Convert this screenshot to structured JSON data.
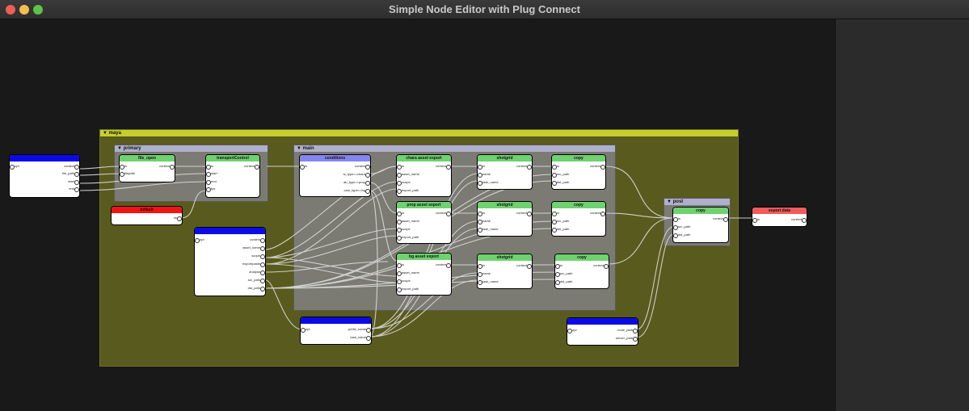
{
  "window": {
    "title": "Simple Node Editor with Plug Connect",
    "controls": [
      "close",
      "minimize",
      "zoom"
    ]
  },
  "colors": {
    "maya_group": "#595a1e",
    "maya_header": "#c5cf2c",
    "subgroup": "#7b7b74",
    "subgroup_header": "#b0b0cc",
    "node_green": "#6fd16f",
    "node_blue": "#0a0ae6",
    "node_red": "#f01414",
    "node_lavender": "#8585f0",
    "node_salmon": "#f25b5b"
  },
  "groups": {
    "maya": {
      "label": "maya"
    },
    "primary": {
      "label": "primary"
    },
    "main": {
      "label": "main"
    },
    "post": {
      "label": "post"
    }
  },
  "nodes": {
    "input_params": {
      "title": "",
      "outputs": [
        "opt",
        "context",
        "file_path",
        "start",
        "end"
      ]
    },
    "file_open": {
      "title": "file_open",
      "inputs": [
        "in",
        "filepath"
      ],
      "outputs": [
        "context"
      ]
    },
    "transportControl": {
      "title": "transportControl",
      "inputs": [
        "in",
        "start",
        "end",
        "fps"
      ],
      "outputs": [
        "context"
      ]
    },
    "default": {
      "title": "default",
      "outputs": [
        "ok"
      ]
    },
    "asset_params": {
      "title": "",
      "outputs": [
        "opt",
        "context",
        "asset_name",
        "scope",
        "export/paste",
        "analyse",
        "src_path",
        "dst_path"
      ]
    },
    "conditions": {
      "title": "conditions",
      "inputs": [
        "in"
      ],
      "outputs": [
        "context",
        "is_type==chara",
        "ab_type==prop",
        "cam_type==bg"
      ]
    },
    "chara_export": {
      "title": "chara asset export",
      "inputs": [
        "in",
        "asset_name",
        "scope",
        "export_path"
      ],
      "outputs": [
        "context"
      ]
    },
    "prop_export": {
      "title": "prop asset export",
      "inputs": [
        "in",
        "asset_name",
        "scope",
        "export_path"
      ],
      "outputs": [
        "context"
      ]
    },
    "bg_export": {
      "title": "bg asset export",
      "inputs": [
        "in",
        "asset_name",
        "scope",
        "export_path"
      ],
      "outputs": [
        "context"
      ]
    },
    "shotgrid_1": {
      "title": "shotgrid",
      "inputs": [
        "in",
        "name",
        "task_name"
      ],
      "outputs": [
        "context"
      ]
    },
    "shotgrid_2": {
      "title": "shotgrid",
      "inputs": [
        "in",
        "name",
        "task_name"
      ],
      "outputs": [
        "context"
      ]
    },
    "shotgrid_3": {
      "title": "shotgrid",
      "inputs": [
        "in",
        "name",
        "task_name"
      ],
      "outputs": [
        "context"
      ]
    },
    "copy_1": {
      "title": "copy",
      "inputs": [
        "in",
        "src_path",
        "dst_path"
      ],
      "outputs": [
        "context"
      ]
    },
    "copy_2": {
      "title": "copy",
      "inputs": [
        "in",
        "src_path",
        "dst_path"
      ],
      "outputs": [
        "context"
      ]
    },
    "copy_3": {
      "title": "copy",
      "inputs": [
        "in",
        "src_path",
        "dst_path"
      ],
      "outputs": [
        "context"
      ]
    },
    "path_params": {
      "title": "",
      "inputs": [
        "opt"
      ],
      "outputs": [
        "prefix_name",
        "task_name"
      ]
    },
    "post_copy": {
      "title": "copy",
      "inputs": [
        "in",
        "src_path",
        "dst_path"
      ],
      "outputs": [
        "context"
      ]
    },
    "server_params": {
      "title": "",
      "inputs": [
        "opt"
      ],
      "outputs": [
        "node_path",
        "server_path"
      ]
    },
    "export_data": {
      "title": "export data",
      "inputs": [
        "in"
      ],
      "outputs": [
        "context"
      ]
    }
  }
}
